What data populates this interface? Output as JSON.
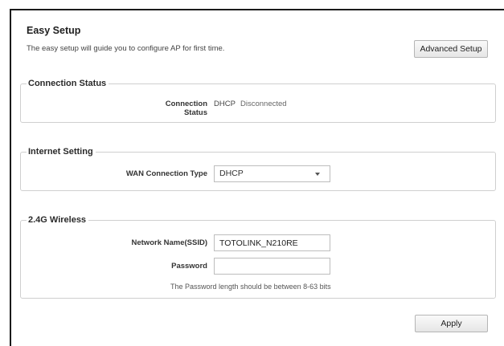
{
  "page": {
    "title": "Easy Setup",
    "subtitle": "The easy setup will guide you to configure AP for first time.",
    "advanced_button": "Advanced Setup",
    "apply_button": "Apply"
  },
  "connection_status": {
    "legend": "Connection Status",
    "label": "Connection Status",
    "protocol": "DHCP",
    "state": "Disconnected"
  },
  "internet_setting": {
    "legend": "Internet Setting",
    "label": "WAN Connection Type",
    "selected": "DHCP"
  },
  "wireless": {
    "legend": "2.4G Wireless",
    "ssid_label": "Network Name(SSID)",
    "ssid_value": "TOTOLINK_N210RE",
    "password_label": "Password",
    "password_value": "",
    "hint": "The Password length should be between 8-63 bits"
  }
}
